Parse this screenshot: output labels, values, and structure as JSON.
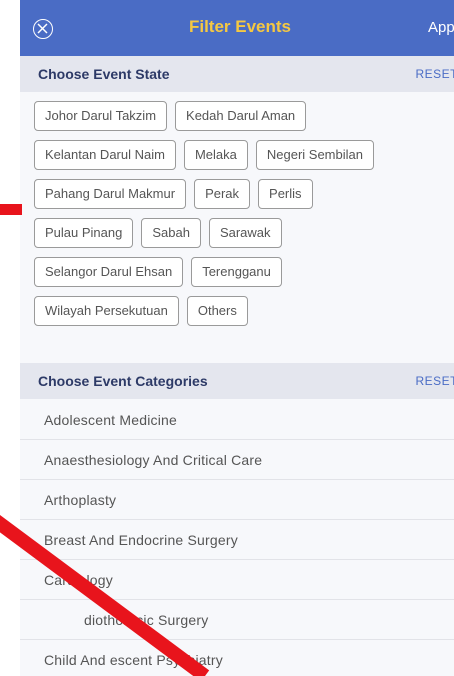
{
  "navbar": {
    "title": "Filter Events",
    "apply_label": "Appl",
    "close_icon": "close-circle-icon"
  },
  "state_section": {
    "title": "Choose Event State",
    "reset_label": "RESET",
    "rows": [
      [
        "Johor Darul Takzim",
        "Kedah Darul Aman"
      ],
      [
        "Kelantan Darul Naim",
        "Melaka",
        "Negeri Sembilan"
      ],
      [
        "Pahang Darul Makmur",
        "Perak",
        "Perlis"
      ],
      [
        "Pulau Pinang",
        "Sabah",
        "Sarawak"
      ],
      [
        "Selangor Darul Ehsan",
        "Terengganu"
      ],
      [
        "Wilayah Persekutuan",
        "Others"
      ]
    ]
  },
  "categories_section": {
    "title": "Choose Event Categories",
    "reset_label": "RESET",
    "items": [
      "Adolescent Medicine",
      "Anaesthesiology And Critical Care",
      "Arthoplasty",
      "Breast And Endocrine Surgery",
      "Cardiology",
      "diothoracic Surgery",
      "Child And escent Psychiatry"
    ]
  },
  "colors": {
    "navbar": "#4a6cc5",
    "title": "#f5c842",
    "annotation": "#e8141c"
  }
}
